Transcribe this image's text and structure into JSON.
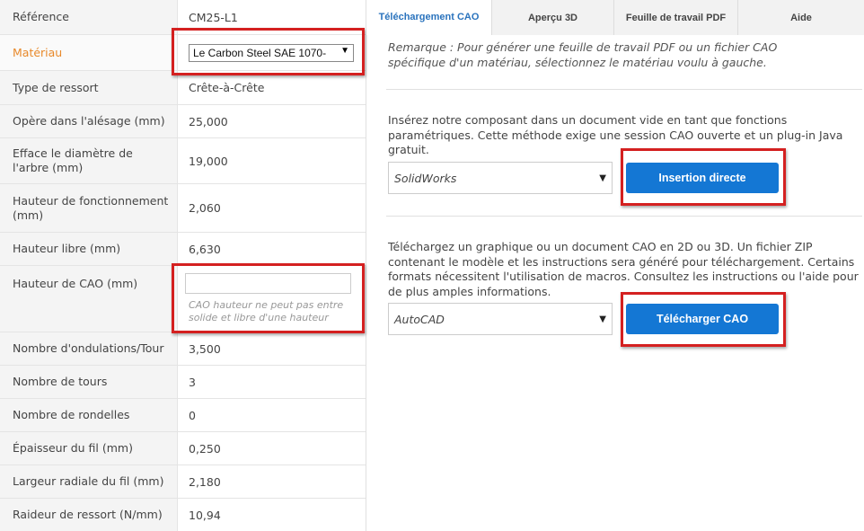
{
  "specs": [
    {
      "label": "Référence",
      "value": "CM25-L1"
    },
    {
      "label": "Matériau",
      "value": ""
    },
    {
      "label": "Type de ressort",
      "value": "Crête-à-Crête"
    },
    {
      "label": "Opère dans l'alésage (mm)",
      "value": "25,000"
    },
    {
      "label": "Efface le diamètre de l'arbre (mm)",
      "value": "19,000"
    },
    {
      "label": "Hauteur de fonctionnement (mm)",
      "value": "2,060"
    },
    {
      "label": "Hauteur libre (mm)",
      "value": "6,630"
    },
    {
      "label": "Hauteur de CAO (mm)",
      "value": ""
    },
    {
      "label": "Nombre d'ondulations/Tour",
      "value": "3,500"
    },
    {
      "label": "Nombre de tours",
      "value": "3"
    },
    {
      "label": "Nombre de rondelles",
      "value": "0"
    },
    {
      "label": "Épaisseur du fil (mm)",
      "value": "0,250"
    },
    {
      "label": "Largeur radiale du fil (mm)",
      "value": "2,180"
    },
    {
      "label": "Raideur de ressort (N/mm)",
      "value": "10,94"
    }
  ],
  "material_select": {
    "value": "Le Carbon Steel SAE 1070-",
    "arrow": "▼"
  },
  "cao_height": {
    "value": "",
    "hint": "CAO hauteur ne peut pas entre solide et libre d'une hauteur"
  },
  "tabs": [
    {
      "label": "Téléchargement CAO",
      "active": true
    },
    {
      "label": "Aperçu 3D",
      "active": false
    },
    {
      "label": "Feuille de travail PDF",
      "active": false
    },
    {
      "label": "Aide",
      "active": false
    }
  ],
  "panel": {
    "note": "Remarque : Pour générer une feuille de travail PDF ou un fichier CAO spécifique d'un matériau, sélectionnez le matériau voulu à gauche.",
    "insert_text": "Insérez notre composant dans un document vide en tant que fonctions paramétriques. Cette méthode exige une session CAO ouverte et un plug-in Java gratuit.",
    "insert_select": "SolidWorks",
    "insert_button": "Insertion directe",
    "download_text": "Téléchargez un graphique ou un document CAO en 2D ou 3D. Un fichier ZIP contenant le modèle et les instructions sera généré pour téléchargement. Certains formats nécessitent l'utilisation de macros. Consultez les instructions ou l'aide pour de plus amples informations.",
    "download_select": "AutoCAD",
    "download_button": "Télécharger CAO",
    "arrow": "▼"
  },
  "colors": {
    "accent": "#1477d4",
    "highlight_label": "#e8892a",
    "callout": "#d42020",
    "active_tab": "#2a73bd"
  }
}
